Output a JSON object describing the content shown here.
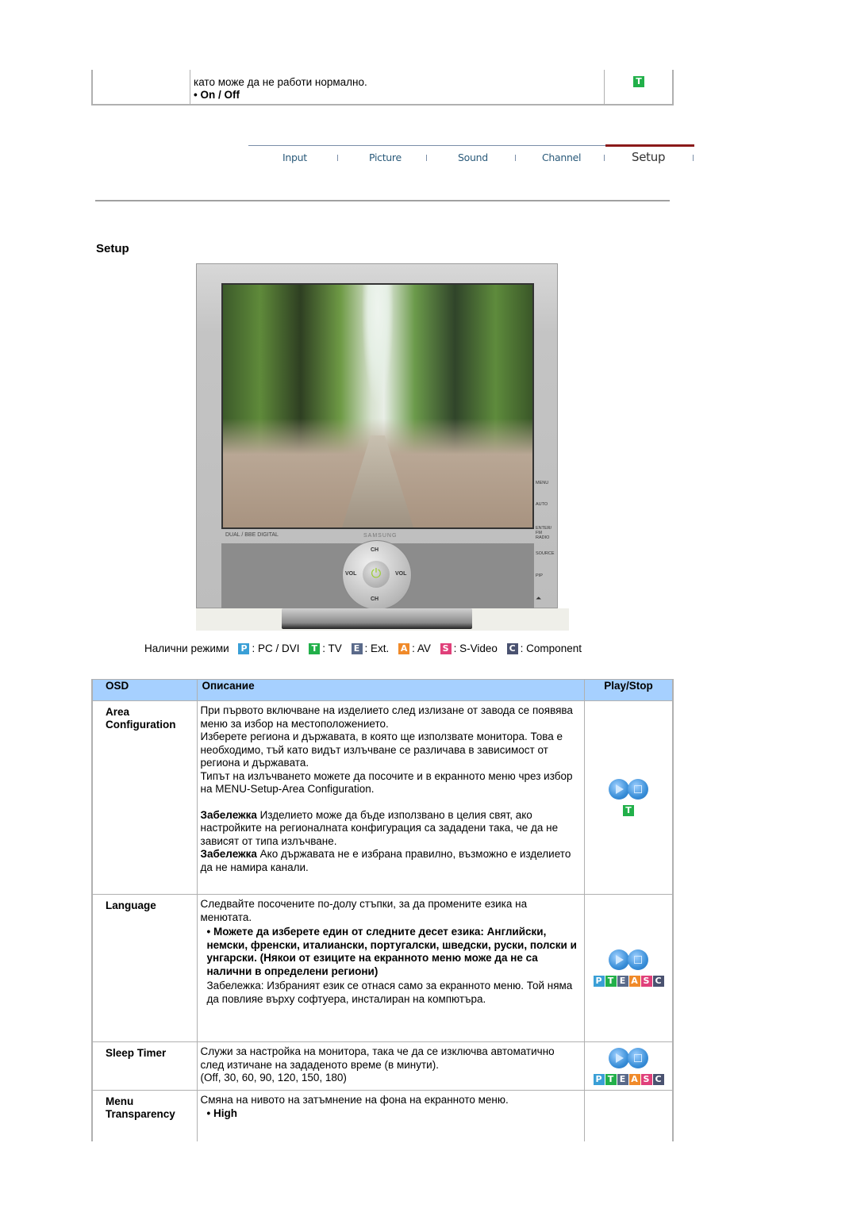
{
  "top_row": {
    "text": "като може да не работи нормално.",
    "option": "• On / Off",
    "mode_badge": "T"
  },
  "nav": {
    "tabs": [
      {
        "label": "Input",
        "active": false
      },
      {
        "label": "Picture",
        "active": false
      },
      {
        "label": "Sound",
        "active": false
      },
      {
        "label": "Channel",
        "active": false
      },
      {
        "label": "Setup",
        "active": true
      }
    ],
    "active_color": "#8b1a1a"
  },
  "section_title": "Setup",
  "monitor": {
    "side_buttons": [
      "MENU",
      "AUTO",
      "ENTER/ FM RADIO",
      "SOURCE",
      "PIP"
    ],
    "control_labels": {
      "ch_up": "CH",
      "ch_down": "CH",
      "vol_minus": "VOL",
      "vol_plus": "VOL"
    },
    "logos": "DUAL / BBE DIGITAL",
    "brand": "SAMSUNG",
    "power_icon": "⏻"
  },
  "modes": {
    "label": "Налични режими",
    "items": [
      {
        "badge": "P",
        "color": "#3a9fd6",
        "name": ": PC / DVI"
      },
      {
        "badge": "T",
        "color": "#22b04a",
        "name": ": TV"
      },
      {
        "badge": "E",
        "color": "#5a6a8a",
        "name": ": Ext."
      },
      {
        "badge": "A",
        "color": "#f08a2a",
        "name": ": AV"
      },
      {
        "badge": "S",
        "color": "#e0407a",
        "name": ": S-Video"
      },
      {
        "badge": "C",
        "color": "#4a5270",
        "name": ": Component"
      }
    ]
  },
  "table": {
    "headers": {
      "osd": "OSD",
      "description": "Описание",
      "playstop": "Play/Stop"
    },
    "header_bg": "#a6d0ff",
    "rows": [
      {
        "osd": [
          "Area",
          "Configuration"
        ],
        "p1": "При първото включване на изделието след излизане от завода се появява меню за избор на местоположението.",
        "p2": "Изберете региона и държавата, в която ще използвате монитора. Това е необходимо, тъй като видът излъчване се различава в зависимост от региона и държавата.",
        "p3": "Типът на излъчването можете да посочите и в екранното меню чрез избор на MENU-Setup-Area Configuration.",
        "note1_label": "Забележка",
        "note1": " Изделието може да бъде използвано в целия свят, ако настройките на регионалната конфигурация са зададени така, че да не зависят от типа излъчване.",
        "note2_label": "Забележка",
        "note2": " Ако държавата не е избрана правилно, възможно е изделието да не намира канали.",
        "badges": [
          "T"
        ]
      },
      {
        "osd": [
          "Language"
        ],
        "p1": "Следвайте посочените по-долу стъпки, за да промените езика на менютата.",
        "bullet": "• Можете да изберете един от следните десет езика: Английски, немски, френски, италиански, португалски, шведски, руски, полски и унгарски. (Някои от езиците на екранното меню може да не са налични в определени региони)",
        "note": "Забележка: Избраният език се отнася само за екранното меню. Той няма да повлияе върху софтуера, инсталиран на компютъра.",
        "badges": [
          "P",
          "T",
          "E",
          "A",
          "S",
          "C"
        ]
      },
      {
        "osd": [
          "Sleep Timer"
        ],
        "p1": "Служи за настройка на монитора, така че да се изключва автоматично след изтичане на зададеното време (в минути).",
        "p2": "(Off, 30, 60, 90, 120, 150, 180)",
        "badges": [
          "P",
          "T",
          "E",
          "A",
          "S",
          "C"
        ]
      },
      {
        "osd": [
          "Menu",
          "Transparency"
        ],
        "p1": "Смяна на нивото на затъмнение на фона на екранното меню.",
        "bullet": "• High"
      }
    ]
  }
}
